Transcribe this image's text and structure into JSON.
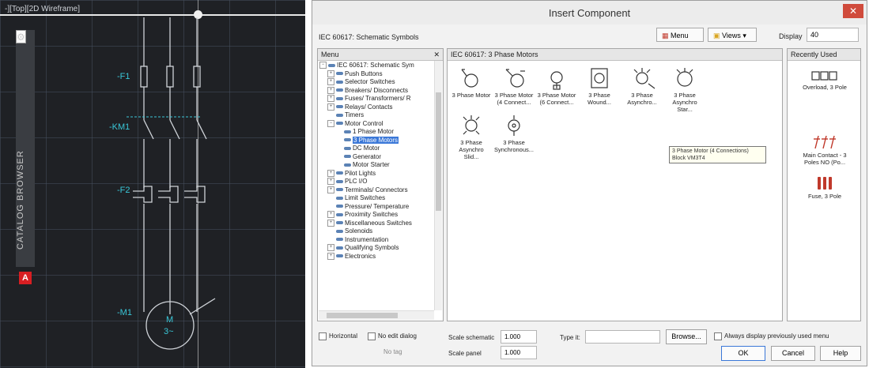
{
  "cad": {
    "view_label": "-][Top][2D Wireframe]",
    "browser_title": "CATALOG BROWSER",
    "browser_buttons": [
      "×",
      "⊳",
      "⚙"
    ],
    "logo": "A",
    "labels": {
      "f1": "-F1",
      "km1": "-KM1",
      "f2": "-F2",
      "m1": "-M1",
      "motor_m": "M",
      "motor_3": "3~"
    }
  },
  "dialog": {
    "title": "Insert Component",
    "library": "IEC 60617: Schematic Symbols",
    "menu_button": "Menu",
    "views_button": "Views ▾",
    "display_label": "Display",
    "display_value": "40",
    "menu_panel_title": "Menu",
    "tree": [
      {
        "label": "IEC 60617: Schematic Sym",
        "level": 0,
        "exp": "−"
      },
      {
        "label": "Push Buttons",
        "level": 1,
        "exp": "+"
      },
      {
        "label": "Selector Switches",
        "level": 1,
        "exp": "+"
      },
      {
        "label": "Breakers/ Disconnects",
        "level": 1,
        "exp": "+"
      },
      {
        "label": "Fuses/ Transformers/ R",
        "level": 1,
        "exp": "+"
      },
      {
        "label": "Relays/ Contacts",
        "level": 1,
        "exp": "+"
      },
      {
        "label": "Timers",
        "level": 1,
        "exp": ""
      },
      {
        "label": "Motor Control",
        "level": 1,
        "exp": "−"
      },
      {
        "label": "1 Phase Motor",
        "level": 2,
        "exp": ""
      },
      {
        "label": "3 Phase Motors",
        "level": 2,
        "exp": "",
        "selected": true
      },
      {
        "label": "DC Motor",
        "level": 2,
        "exp": ""
      },
      {
        "label": "Generator",
        "level": 2,
        "exp": ""
      },
      {
        "label": "Motor Starter",
        "level": 2,
        "exp": ""
      },
      {
        "label": "Pilot Lights",
        "level": 1,
        "exp": "+"
      },
      {
        "label": "PLC I/O",
        "level": 1,
        "exp": "+"
      },
      {
        "label": "Terminals/ Connectors",
        "level": 1,
        "exp": "+"
      },
      {
        "label": "Limit Switches",
        "level": 1,
        "exp": ""
      },
      {
        "label": "Pressure/ Temperature",
        "level": 1,
        "exp": ""
      },
      {
        "label": "Proximity Switches",
        "level": 1,
        "exp": "+"
      },
      {
        "label": "Miscellaneous Switches",
        "level": 1,
        "exp": "+"
      },
      {
        "label": "Solenoids",
        "level": 1,
        "exp": ""
      },
      {
        "label": "Instrumentation",
        "level": 1,
        "exp": ""
      },
      {
        "label": "Qualifying Symbols",
        "level": 1,
        "exp": "+"
      },
      {
        "label": "Electronics",
        "level": 1,
        "exp": "+"
      }
    ],
    "components_panel_title": "IEC 60617: 3 Phase Motors",
    "components": [
      {
        "label": "3 Phase Motor"
      },
      {
        "label": "3 Phase Motor (4 Connect..."
      },
      {
        "label": "3 Phase Motor (6 Connect..."
      },
      {
        "label": "3 Phase Wound..."
      },
      {
        "label": "3 Phase Asynchro..."
      },
      {
        "label": "3 Phase Asynchro Star..."
      },
      {
        "label": "3 Phase Asynchro Slid..."
      },
      {
        "label": "3 Phase Synchronous..."
      }
    ],
    "tooltip": "3 Phase Motor (4 Connections) Block VM3T4",
    "recent_panel_title": "Recently Used",
    "recent": [
      {
        "label": "Overload, 3 Pole"
      },
      {
        "label": "Main Contact - 3 Poles NO (Po..."
      },
      {
        "label": "Fuse, 3 Pole"
      }
    ],
    "horizontal_label": "Horizontal",
    "no_edit_label": "No edit dialog",
    "no_tag_label": "No tag",
    "scale_schematic_label": "Scale schematic",
    "scale_schematic_value": "1.000",
    "scale_panel_label": "Scale panel",
    "scale_panel_value": "1.000",
    "type_it_label": "Type it:",
    "type_it_value": "",
    "browse_button": "Browse...",
    "always_display_label": "Always display previously used menu",
    "ok_button": "OK",
    "cancel_button": "Cancel",
    "help_button": "Help"
  }
}
